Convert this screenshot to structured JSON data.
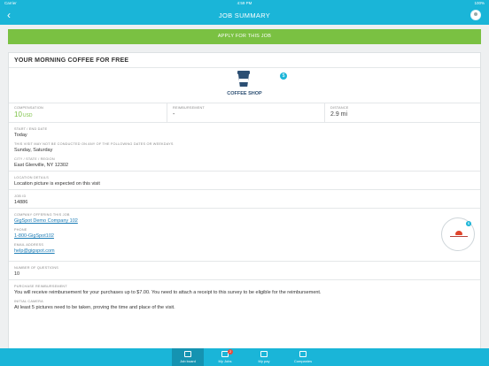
{
  "status_bar": {
    "carrier": "Carrier",
    "time": "4:59 PM",
    "battery": "100%"
  },
  "nav": {
    "back_icon": "chevron-left",
    "title": "JOB SUMMARY",
    "profile_icon": "user-avatar"
  },
  "apply_button": {
    "label": "APPLY FOR THIS JOB",
    "color": "#7ac142"
  },
  "job": {
    "title": "YOUR MORNING COFFEE FOR FREE",
    "shop_label": "COFFEE SHOP",
    "badge_icon": "dollar-badge",
    "compensation": {
      "label": "COMPENSATION",
      "amount": "10",
      "currency": "USD"
    },
    "reimbursement": {
      "label": "REIMBURSEMENT",
      "value": "-"
    },
    "distance": {
      "label": "DISTANCE",
      "value": "2.9 mi"
    },
    "dates": {
      "label": "START / END DATE",
      "value": "Today"
    },
    "weekdays": {
      "label": "THIS VISIT MAY NOT BE CONDUCTED ON ANY OF THE FOLLOWING DATES OR WEEKDAYS",
      "value": "Sunday, Saturday"
    },
    "location": {
      "label": "CITY / STATE / REGION",
      "value": "East Glenville, NY 12302"
    },
    "location_details": {
      "label": "LOCATION DETAILS",
      "value": "Location picture is expected on this visit"
    },
    "job_id": {
      "label": "JOB ID",
      "value": "14886"
    },
    "company": {
      "label": "COMPANY OFFERING THIS JOB",
      "value": "GigSpot Demo Company 102"
    },
    "phone": {
      "label": "PHONE",
      "value": "1-800-GigSpot102"
    },
    "email": {
      "label": "EMAIL ADDRESS",
      "value": "help@gigspot.com"
    },
    "questions": {
      "label": "NUMBER OF QUESTIONS",
      "value": "10"
    },
    "purchase": {
      "label": "PURCHASE REIMBURSEMENT",
      "value": "You will receive reimbursement for your purchases up to $7.00. You need to attach a receipt to this survey to be eligible for the reimbursement."
    },
    "camera": {
      "label": "INITIAL CAMERA",
      "value": "At least 5 pictures need to be taken, proving the time and place of the visit."
    }
  },
  "tabs": [
    {
      "label": "Job board",
      "icon": "job-board-icon",
      "active": true
    },
    {
      "label": "My Jobs",
      "icon": "my-jobs-icon",
      "badge": "2"
    },
    {
      "label": "My pay",
      "icon": "my-pay-icon"
    },
    {
      "label": "Companies",
      "icon": "companies-icon"
    }
  ],
  "colors": {
    "primary": "#1ab5d8",
    "accent": "#7ac142",
    "link": "#1a7bb5"
  }
}
